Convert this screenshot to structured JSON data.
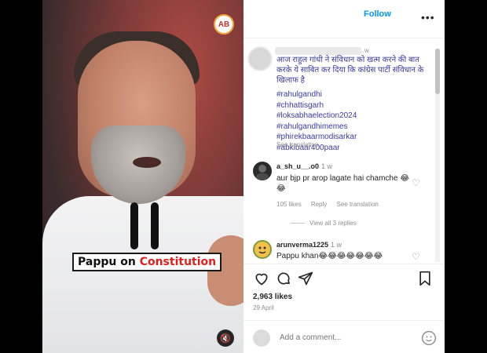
{
  "post": {
    "follow_label": "Follow",
    "more_glyph": "•••",
    "logo_text": "AB",
    "post_time": "w",
    "caption_hindi": "आज राहुल गांधी ने संविधान को खत्म करने की बात करके ये साबित कर दिया कि कांग्रेस पार्टी संविधान के खिलाफ है",
    "hashtags": [
      "#rahulgandhi",
      "#chhattisgarh",
      "#loksabhaelection2024",
      "#rahulgandhimemes",
      "#phirekbaarmodisarkar",
      "#abkibaar400paar"
    ],
    "see_translation": "See translation"
  },
  "media": {
    "caption_prefix": "Pappu on ",
    "caption_accent": "Constitution",
    "sound_glyph": "🔇"
  },
  "comments": [
    {
      "username": "a_sh_u__.o0",
      "time": "1 w",
      "text": "aur bjp pr arop lagate hai chamche 😂😂",
      "likes": "105 likes",
      "reply": "Reply",
      "see_translation": "See translation",
      "view_replies": "View all 3 replies",
      "avatar_color": "#2b2b2b"
    },
    {
      "username": "arunverma1225",
      "time": "1 w",
      "text": "Pappu khan😂😂😂😂😂😂😂",
      "avatar_color": "#7a9b3a"
    }
  ],
  "actions": {
    "likes": "2,963 likes",
    "date": "29 April"
  },
  "add_comment": {
    "placeholder": "Add a comment..."
  },
  "colors": {
    "link_blue": "#0095f6",
    "caption_accent": "#e0201d"
  }
}
